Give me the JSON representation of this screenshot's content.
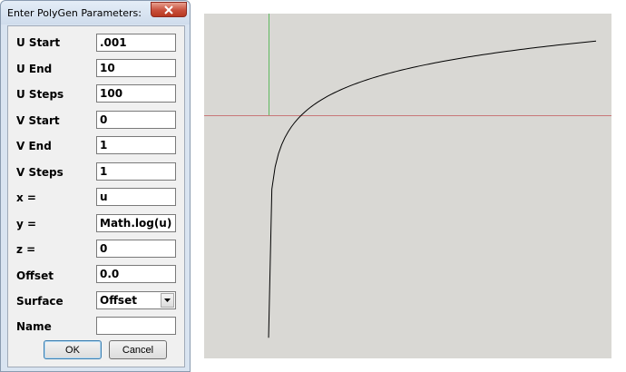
{
  "dialog": {
    "title": "Enter PolyGen Parameters:",
    "fields": [
      {
        "label": "U Start",
        "value": ".001"
      },
      {
        "label": "U End",
        "value": "10"
      },
      {
        "label": "U Steps",
        "value": "100"
      },
      {
        "label": "V Start",
        "value": "0"
      },
      {
        "label": "V End",
        "value": "1"
      },
      {
        "label": "V Steps",
        "value": "1"
      },
      {
        "label": "x =",
        "value": "u"
      },
      {
        "label": "y =",
        "value": "Math.log(u)"
      },
      {
        "label": "z =",
        "value": "0"
      },
      {
        "label": "Offset",
        "value": "0.0"
      }
    ],
    "surface": {
      "label": "Surface",
      "value": "Offset"
    },
    "name": {
      "label": "Name",
      "value": ""
    },
    "ok_label": "OK",
    "cancel_label": "Cancel"
  },
  "viewport": {
    "background": "#d9d8d4",
    "x_axis_color": "#c87878",
    "y_axis_color": "#5fb85f",
    "curve_color": "#000000",
    "curve": {
      "equation": "y = Math.log(u)",
      "u_start": 0.001,
      "u_end": 10,
      "u_steps": 100
    }
  },
  "icons": {
    "close": "close-icon",
    "dropdown": "chevron-down-icon"
  }
}
